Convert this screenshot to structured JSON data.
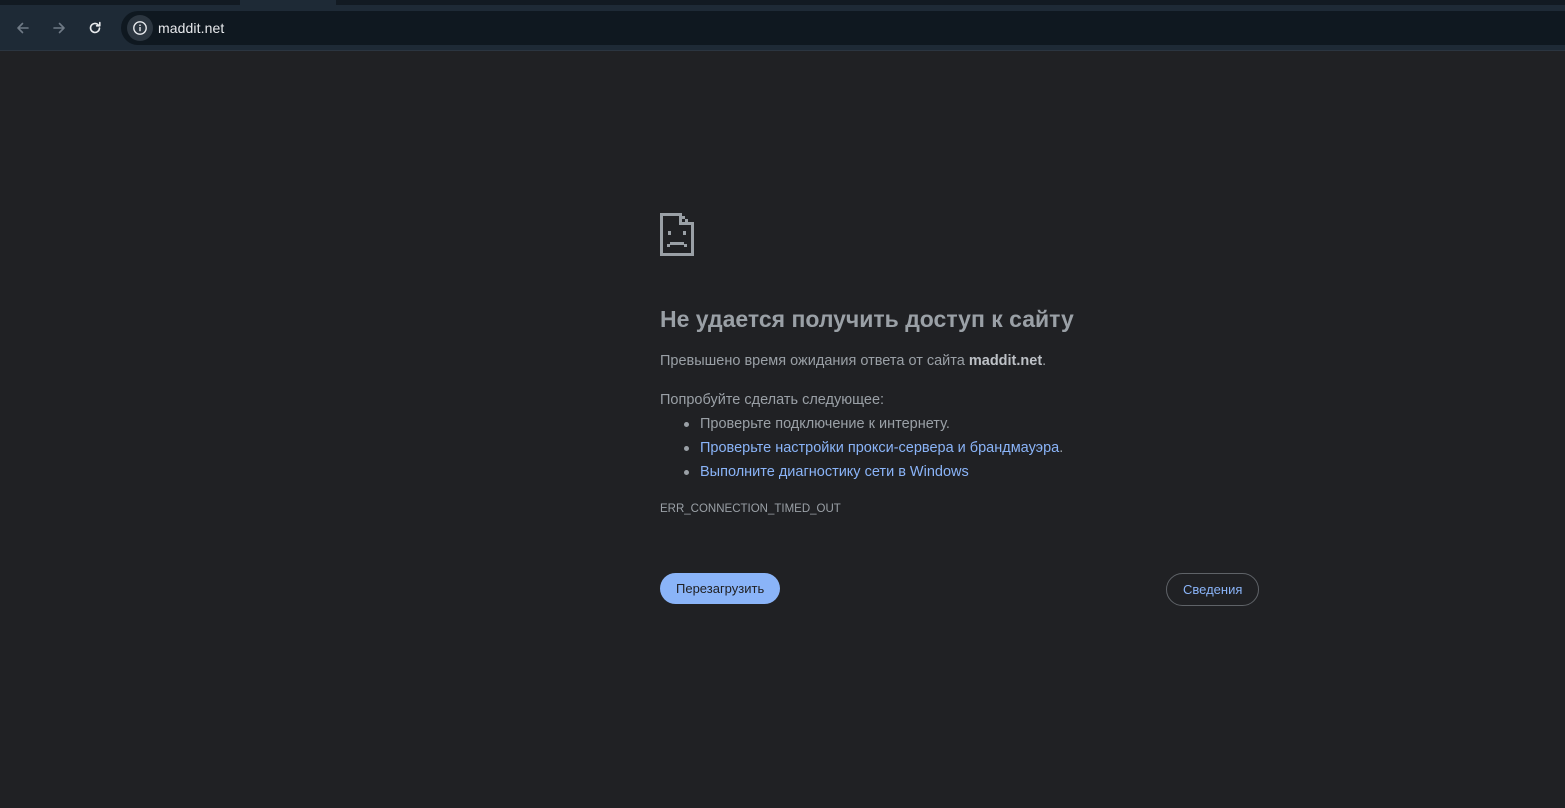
{
  "browser": {
    "url": "maddit.net",
    "back_icon": "back-arrow-icon",
    "forward_icon": "forward-arrow-icon",
    "reload_icon": "reload-icon",
    "site_info_icon": "info-icon"
  },
  "error": {
    "icon": "sad-page-icon",
    "title": "Не удается получить доступ к сайту",
    "description_prefix": "Превышено время ожидания ответа от сайта",
    "description_host": "maddit.net",
    "description_suffix": ".",
    "suggestions_title": "Попробуйте сделать следующее:",
    "suggestions": [
      {
        "text": "Проверьте подключение к интернету.",
        "link": false
      },
      {
        "text": "Проверьте настройки прокси-сервера и брандмауэра",
        "suffix": ".",
        "link": true
      },
      {
        "text": "Выполните диагностику сети в Windows",
        "suffix": "",
        "link": true
      }
    ],
    "code": "ERR_CONNECTION_TIMED_OUT",
    "reload_label": "Перезагрузить",
    "details_label": "Сведения"
  },
  "colors": {
    "background": "#202124",
    "toolbar": "#1e2a36",
    "link": "#8ab4f8",
    "text": "#9aa0a6"
  }
}
